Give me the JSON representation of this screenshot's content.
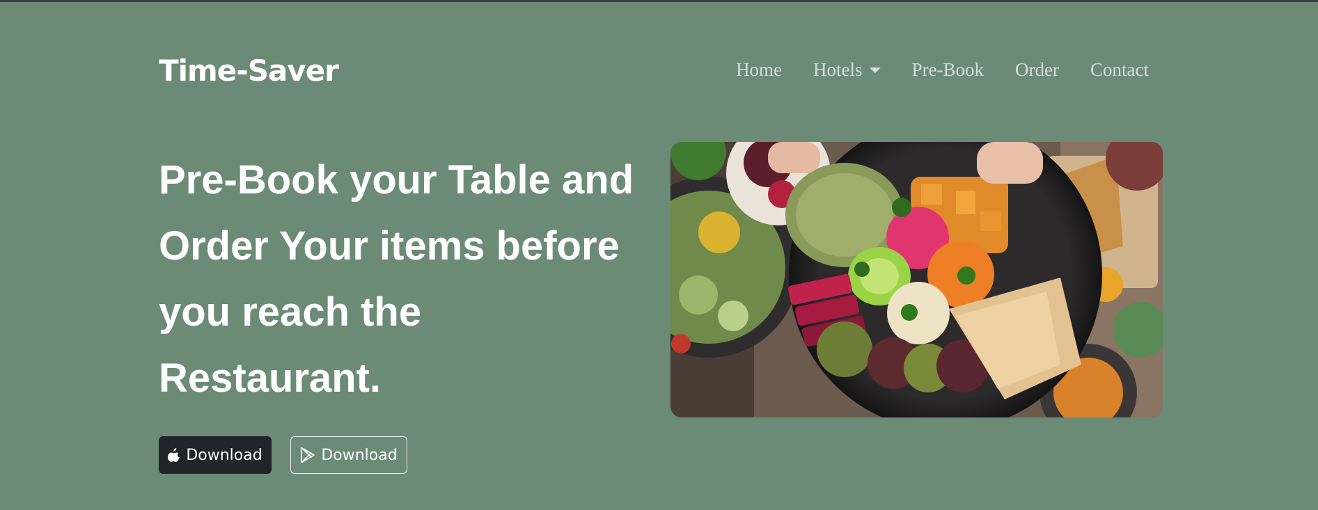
{
  "brand": "Time-Saver",
  "nav": {
    "home": "Home",
    "hotels": "Hotels",
    "prebook": "Pre-Book",
    "order": "Order",
    "contact": "Contact"
  },
  "hero": {
    "headline": "Pre-Book your Table and Order Your items before you reach the Restaurant.",
    "apple_button": "Download",
    "play_button": "Download",
    "image": "food-bowl-photo"
  },
  "icons": [
    "apple-icon",
    "google-play-icon",
    "chevron-down-icon"
  ],
  "colors": {
    "background": "#6c8b76",
    "dark_button": "#212428",
    "nav_text": "#d3dfd6"
  }
}
